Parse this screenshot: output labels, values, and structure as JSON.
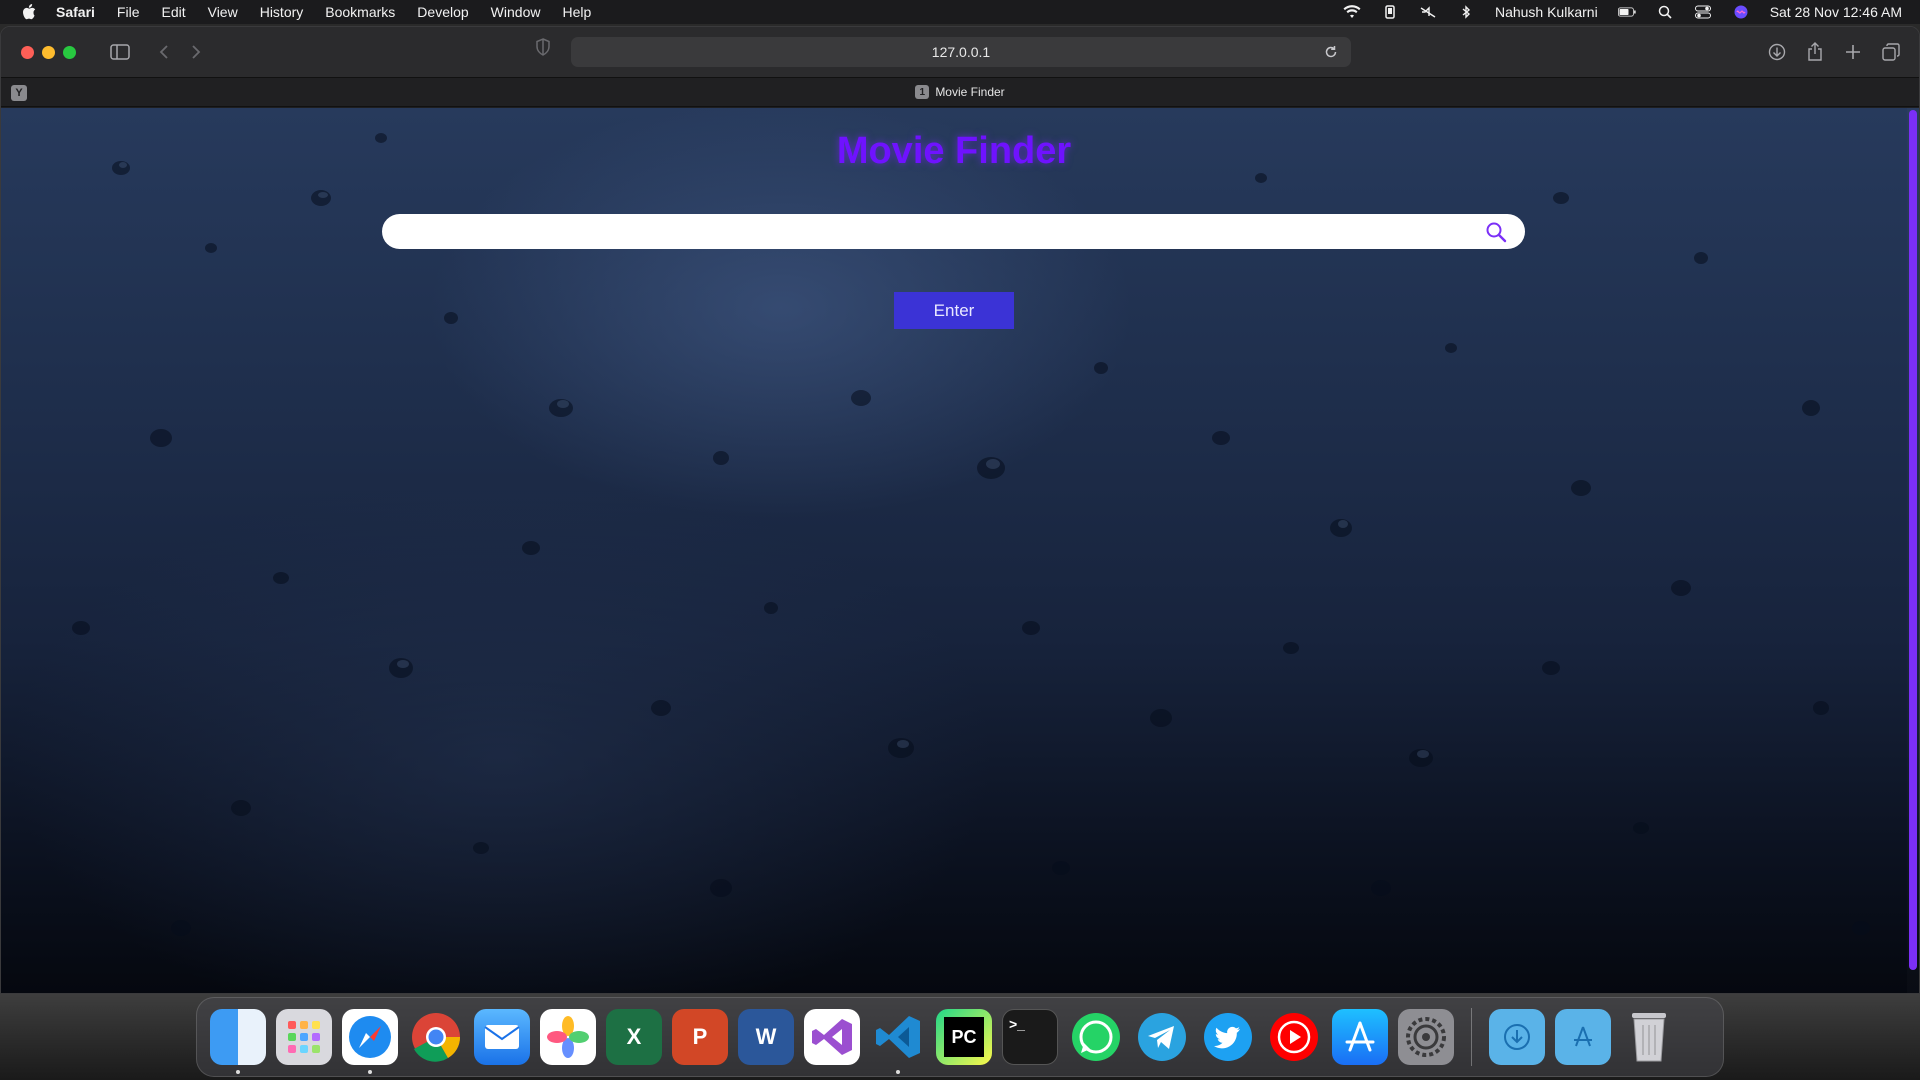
{
  "menubar": {
    "app_name": "Safari",
    "items": [
      "File",
      "Edit",
      "View",
      "History",
      "Bookmarks",
      "Develop",
      "Window",
      "Help"
    ],
    "user_name": "Nahush Kulkarni",
    "datetime": "Sat 28 Nov  12:46 AM"
  },
  "browser": {
    "address": "127.0.0.1",
    "pinned_tab_letter": "Y",
    "tab": {
      "favicon_text": "1",
      "title": "Movie Finder"
    }
  },
  "page": {
    "title": "Movie Finder",
    "search": {
      "value": "",
      "placeholder": ""
    },
    "enter_label": "Enter",
    "colors": {
      "title": "#6f12ff",
      "button": "#3b33d6",
      "scrollbar": "#7b2ff7"
    }
  },
  "dock": {
    "apps": [
      {
        "name": "finder-icon",
        "running": true
      },
      {
        "name": "launchpad-icon",
        "running": false
      },
      {
        "name": "safari-icon",
        "running": true
      },
      {
        "name": "chrome-icon",
        "running": false
      },
      {
        "name": "mail-icon",
        "running": false
      },
      {
        "name": "photos-icon",
        "running": false
      },
      {
        "name": "excel-icon",
        "label": "X",
        "running": false
      },
      {
        "name": "powerpoint-icon",
        "label": "P",
        "running": false
      },
      {
        "name": "word-icon",
        "label": "W",
        "running": false
      },
      {
        "name": "visual-studio-icon",
        "running": false
      },
      {
        "name": "vscode-icon",
        "running": true
      },
      {
        "name": "pycharm-icon",
        "label": "PC",
        "running": false
      },
      {
        "name": "terminal-icon",
        "label": ">_",
        "running": false
      },
      {
        "name": "whatsapp-icon",
        "running": false
      },
      {
        "name": "telegram-icon",
        "running": false
      },
      {
        "name": "twitter-icon",
        "running": false
      },
      {
        "name": "youtube-icon",
        "running": false
      },
      {
        "name": "app-store-icon",
        "running": false
      },
      {
        "name": "system-preferences-icon",
        "running": false
      }
    ]
  }
}
